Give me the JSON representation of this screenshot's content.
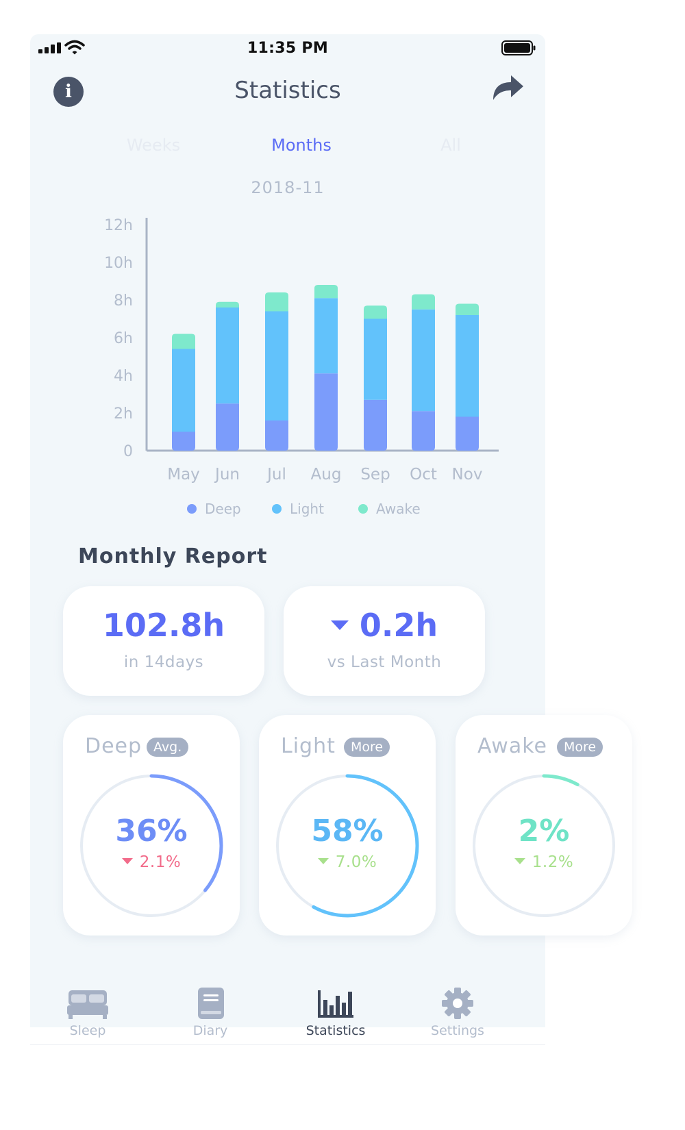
{
  "status_bar": {
    "time": "11:35 PM"
  },
  "header": {
    "title": "Statistics"
  },
  "segments": {
    "weeks": "Weeks",
    "months": "Months",
    "all": "All",
    "active": "months"
  },
  "period": "2018-11",
  "chart_data": {
    "type": "bar",
    "stacked": true,
    "categories": [
      "May",
      "Jun",
      "Jul",
      "Aug",
      "Sep",
      "Oct",
      "Nov"
    ],
    "series": [
      {
        "name": "Deep",
        "color": "#7b9cfb",
        "values": [
          1.0,
          2.5,
          1.6,
          4.1,
          2.7,
          2.1,
          1.8
        ]
      },
      {
        "name": "Light",
        "color": "#62c2fb",
        "values": [
          4.4,
          5.1,
          5.8,
          4.0,
          4.3,
          5.4,
          5.4
        ]
      },
      {
        "name": "Awake",
        "color": "#7ee9cc",
        "values": [
          0.8,
          0.3,
          1.0,
          0.7,
          0.7,
          0.8,
          0.6
        ]
      }
    ],
    "ylim": [
      0,
      12
    ],
    "yticks": [
      "0",
      "2h",
      "4h",
      "6h",
      "8h",
      "10h",
      "12h"
    ],
    "legend_position": "bottom"
  },
  "report": {
    "title": "Monthly Report",
    "total": {
      "value": "102.8h",
      "caption": "in 14days"
    },
    "diff": {
      "value": "0.2h",
      "caption": "vs Last Month",
      "direction": "down"
    },
    "rings": [
      {
        "name": "Deep",
        "tag": "Avg.",
        "percent": "36%",
        "change": "2.1%",
        "direction": "down",
        "fraction": 0.36,
        "color": "#7b9cfb",
        "pct_color": "#6d8df6",
        "change_color": "#f26b8a"
      },
      {
        "name": "Light",
        "tag": "More",
        "percent": "58%",
        "change": "7.0%",
        "direction": "down",
        "fraction": 0.58,
        "color": "#62c2fb",
        "pct_color": "#5bb7f5",
        "change_color": "#a8e08c"
      },
      {
        "name": "Awake",
        "tag": "More",
        "percent": "2%",
        "change": "1.2%",
        "direction": "down",
        "fraction": 0.08,
        "color": "#7ee9cc",
        "pct_color": "#6fe3c6",
        "change_color": "#a8e08c"
      }
    ]
  },
  "tabbar": [
    {
      "label": "Sleep",
      "icon": "bed-icon",
      "active": false
    },
    {
      "label": "Diary",
      "icon": "book-icon",
      "active": false
    },
    {
      "label": "Statistics",
      "icon": "bar-chart-icon",
      "active": true
    },
    {
      "label": "Settings",
      "icon": "gear-icon",
      "active": false
    }
  ]
}
